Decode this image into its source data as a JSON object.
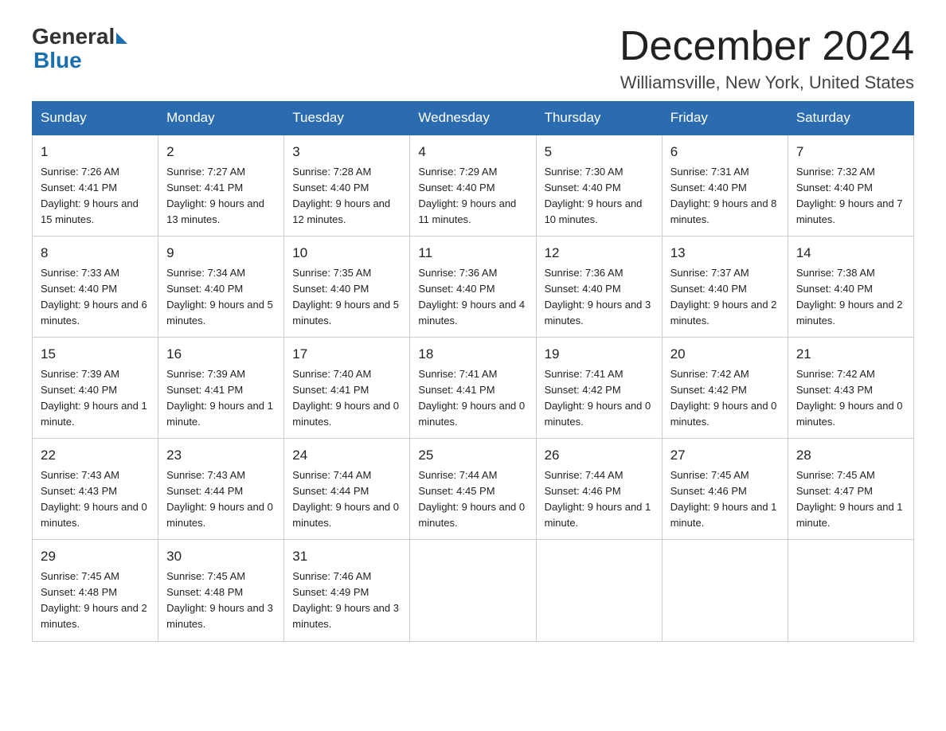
{
  "logo": {
    "text_general": "General",
    "text_blue": "Blue",
    "triangle_color": "#1a6faf"
  },
  "header": {
    "month_title": "December 2024",
    "location": "Williamsville, New York, United States"
  },
  "days_of_week": [
    "Sunday",
    "Monday",
    "Tuesday",
    "Wednesday",
    "Thursday",
    "Friday",
    "Saturday"
  ],
  "weeks": [
    [
      {
        "day": "1",
        "sunrise": "Sunrise: 7:26 AM",
        "sunset": "Sunset: 4:41 PM",
        "daylight": "Daylight: 9 hours and 15 minutes."
      },
      {
        "day": "2",
        "sunrise": "Sunrise: 7:27 AM",
        "sunset": "Sunset: 4:41 PM",
        "daylight": "Daylight: 9 hours and 13 minutes."
      },
      {
        "day": "3",
        "sunrise": "Sunrise: 7:28 AM",
        "sunset": "Sunset: 4:40 PM",
        "daylight": "Daylight: 9 hours and 12 minutes."
      },
      {
        "day": "4",
        "sunrise": "Sunrise: 7:29 AM",
        "sunset": "Sunset: 4:40 PM",
        "daylight": "Daylight: 9 hours and 11 minutes."
      },
      {
        "day": "5",
        "sunrise": "Sunrise: 7:30 AM",
        "sunset": "Sunset: 4:40 PM",
        "daylight": "Daylight: 9 hours and 10 minutes."
      },
      {
        "day": "6",
        "sunrise": "Sunrise: 7:31 AM",
        "sunset": "Sunset: 4:40 PM",
        "daylight": "Daylight: 9 hours and 8 minutes."
      },
      {
        "day": "7",
        "sunrise": "Sunrise: 7:32 AM",
        "sunset": "Sunset: 4:40 PM",
        "daylight": "Daylight: 9 hours and 7 minutes."
      }
    ],
    [
      {
        "day": "8",
        "sunrise": "Sunrise: 7:33 AM",
        "sunset": "Sunset: 4:40 PM",
        "daylight": "Daylight: 9 hours and 6 minutes."
      },
      {
        "day": "9",
        "sunrise": "Sunrise: 7:34 AM",
        "sunset": "Sunset: 4:40 PM",
        "daylight": "Daylight: 9 hours and 5 minutes."
      },
      {
        "day": "10",
        "sunrise": "Sunrise: 7:35 AM",
        "sunset": "Sunset: 4:40 PM",
        "daylight": "Daylight: 9 hours and 5 minutes."
      },
      {
        "day": "11",
        "sunrise": "Sunrise: 7:36 AM",
        "sunset": "Sunset: 4:40 PM",
        "daylight": "Daylight: 9 hours and 4 minutes."
      },
      {
        "day": "12",
        "sunrise": "Sunrise: 7:36 AM",
        "sunset": "Sunset: 4:40 PM",
        "daylight": "Daylight: 9 hours and 3 minutes."
      },
      {
        "day": "13",
        "sunrise": "Sunrise: 7:37 AM",
        "sunset": "Sunset: 4:40 PM",
        "daylight": "Daylight: 9 hours and 2 minutes."
      },
      {
        "day": "14",
        "sunrise": "Sunrise: 7:38 AM",
        "sunset": "Sunset: 4:40 PM",
        "daylight": "Daylight: 9 hours and 2 minutes."
      }
    ],
    [
      {
        "day": "15",
        "sunrise": "Sunrise: 7:39 AM",
        "sunset": "Sunset: 4:40 PM",
        "daylight": "Daylight: 9 hours and 1 minute."
      },
      {
        "day": "16",
        "sunrise": "Sunrise: 7:39 AM",
        "sunset": "Sunset: 4:41 PM",
        "daylight": "Daylight: 9 hours and 1 minute."
      },
      {
        "day": "17",
        "sunrise": "Sunrise: 7:40 AM",
        "sunset": "Sunset: 4:41 PM",
        "daylight": "Daylight: 9 hours and 0 minutes."
      },
      {
        "day": "18",
        "sunrise": "Sunrise: 7:41 AM",
        "sunset": "Sunset: 4:41 PM",
        "daylight": "Daylight: 9 hours and 0 minutes."
      },
      {
        "day": "19",
        "sunrise": "Sunrise: 7:41 AM",
        "sunset": "Sunset: 4:42 PM",
        "daylight": "Daylight: 9 hours and 0 minutes."
      },
      {
        "day": "20",
        "sunrise": "Sunrise: 7:42 AM",
        "sunset": "Sunset: 4:42 PM",
        "daylight": "Daylight: 9 hours and 0 minutes."
      },
      {
        "day": "21",
        "sunrise": "Sunrise: 7:42 AM",
        "sunset": "Sunset: 4:43 PM",
        "daylight": "Daylight: 9 hours and 0 minutes."
      }
    ],
    [
      {
        "day": "22",
        "sunrise": "Sunrise: 7:43 AM",
        "sunset": "Sunset: 4:43 PM",
        "daylight": "Daylight: 9 hours and 0 minutes."
      },
      {
        "day": "23",
        "sunrise": "Sunrise: 7:43 AM",
        "sunset": "Sunset: 4:44 PM",
        "daylight": "Daylight: 9 hours and 0 minutes."
      },
      {
        "day": "24",
        "sunrise": "Sunrise: 7:44 AM",
        "sunset": "Sunset: 4:44 PM",
        "daylight": "Daylight: 9 hours and 0 minutes."
      },
      {
        "day": "25",
        "sunrise": "Sunrise: 7:44 AM",
        "sunset": "Sunset: 4:45 PM",
        "daylight": "Daylight: 9 hours and 0 minutes."
      },
      {
        "day": "26",
        "sunrise": "Sunrise: 7:44 AM",
        "sunset": "Sunset: 4:46 PM",
        "daylight": "Daylight: 9 hours and 1 minute."
      },
      {
        "day": "27",
        "sunrise": "Sunrise: 7:45 AM",
        "sunset": "Sunset: 4:46 PM",
        "daylight": "Daylight: 9 hours and 1 minute."
      },
      {
        "day": "28",
        "sunrise": "Sunrise: 7:45 AM",
        "sunset": "Sunset: 4:47 PM",
        "daylight": "Daylight: 9 hours and 1 minute."
      }
    ],
    [
      {
        "day": "29",
        "sunrise": "Sunrise: 7:45 AM",
        "sunset": "Sunset: 4:48 PM",
        "daylight": "Daylight: 9 hours and 2 minutes."
      },
      {
        "day": "30",
        "sunrise": "Sunrise: 7:45 AM",
        "sunset": "Sunset: 4:48 PM",
        "daylight": "Daylight: 9 hours and 3 minutes."
      },
      {
        "day": "31",
        "sunrise": "Sunrise: 7:46 AM",
        "sunset": "Sunset: 4:49 PM",
        "daylight": "Daylight: 9 hours and 3 minutes."
      },
      null,
      null,
      null,
      null
    ]
  ]
}
